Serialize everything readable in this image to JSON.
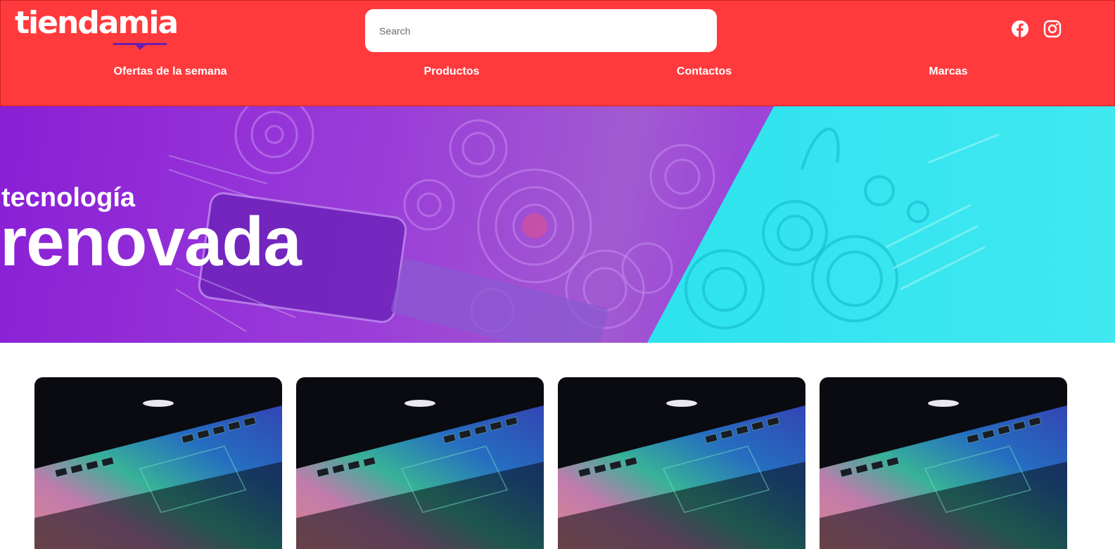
{
  "header": {
    "logo_text": "tiendamia",
    "search": {
      "placeholder": "Search",
      "value": ""
    },
    "social": [
      "facebook-icon",
      "instagram-icon"
    ],
    "nav": [
      {
        "label": "Ofertas de la semana"
      },
      {
        "label": "Productos"
      },
      {
        "label": "Contactos"
      },
      {
        "label": "Marcas"
      }
    ]
  },
  "banner": {
    "line1": "tecnología",
    "line2": "renovada"
  },
  "products": [
    {
      "image": "laptop-keyboard-image"
    },
    {
      "image": "laptop-keyboard-image"
    },
    {
      "image": "laptop-keyboard-image"
    },
    {
      "image": "laptop-keyboard-image"
    }
  ],
  "colors": {
    "header_bg": "#ff3a3d",
    "banner_purple": "#8a1fd6",
    "banner_cyan": "#22d8e8",
    "logo_accent": "#6a1fb0"
  }
}
